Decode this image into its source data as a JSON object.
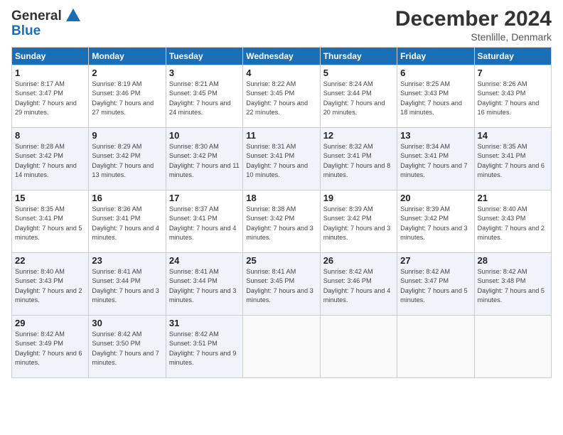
{
  "logo": {
    "line1": "General",
    "line2": "Blue"
  },
  "header": {
    "month": "December 2024",
    "location": "Stenlille, Denmark"
  },
  "weekdays": [
    "Sunday",
    "Monday",
    "Tuesday",
    "Wednesday",
    "Thursday",
    "Friday",
    "Saturday"
  ],
  "weeks": [
    [
      {
        "day": "1",
        "sunrise": "Sunrise: 8:17 AM",
        "sunset": "Sunset: 3:47 PM",
        "daylight": "Daylight: 7 hours and 29 minutes."
      },
      {
        "day": "2",
        "sunrise": "Sunrise: 8:19 AM",
        "sunset": "Sunset: 3:46 PM",
        "daylight": "Daylight: 7 hours and 27 minutes."
      },
      {
        "day": "3",
        "sunrise": "Sunrise: 8:21 AM",
        "sunset": "Sunset: 3:45 PM",
        "daylight": "Daylight: 7 hours and 24 minutes."
      },
      {
        "day": "4",
        "sunrise": "Sunrise: 8:22 AM",
        "sunset": "Sunset: 3:45 PM",
        "daylight": "Daylight: 7 hours and 22 minutes."
      },
      {
        "day": "5",
        "sunrise": "Sunrise: 8:24 AM",
        "sunset": "Sunset: 3:44 PM",
        "daylight": "Daylight: 7 hours and 20 minutes."
      },
      {
        "day": "6",
        "sunrise": "Sunrise: 8:25 AM",
        "sunset": "Sunset: 3:43 PM",
        "daylight": "Daylight: 7 hours and 18 minutes."
      },
      {
        "day": "7",
        "sunrise": "Sunrise: 8:26 AM",
        "sunset": "Sunset: 3:43 PM",
        "daylight": "Daylight: 7 hours and 16 minutes."
      }
    ],
    [
      {
        "day": "8",
        "sunrise": "Sunrise: 8:28 AM",
        "sunset": "Sunset: 3:42 PM",
        "daylight": "Daylight: 7 hours and 14 minutes."
      },
      {
        "day": "9",
        "sunrise": "Sunrise: 8:29 AM",
        "sunset": "Sunset: 3:42 PM",
        "daylight": "Daylight: 7 hours and 13 minutes."
      },
      {
        "day": "10",
        "sunrise": "Sunrise: 8:30 AM",
        "sunset": "Sunset: 3:42 PM",
        "daylight": "Daylight: 7 hours and 11 minutes."
      },
      {
        "day": "11",
        "sunrise": "Sunrise: 8:31 AM",
        "sunset": "Sunset: 3:41 PM",
        "daylight": "Daylight: 7 hours and 10 minutes."
      },
      {
        "day": "12",
        "sunrise": "Sunrise: 8:32 AM",
        "sunset": "Sunset: 3:41 PM",
        "daylight": "Daylight: 7 hours and 8 minutes."
      },
      {
        "day": "13",
        "sunrise": "Sunrise: 8:34 AM",
        "sunset": "Sunset: 3:41 PM",
        "daylight": "Daylight: 7 hours and 7 minutes."
      },
      {
        "day": "14",
        "sunrise": "Sunrise: 8:35 AM",
        "sunset": "Sunset: 3:41 PM",
        "daylight": "Daylight: 7 hours and 6 minutes."
      }
    ],
    [
      {
        "day": "15",
        "sunrise": "Sunrise: 8:35 AM",
        "sunset": "Sunset: 3:41 PM",
        "daylight": "Daylight: 7 hours and 5 minutes."
      },
      {
        "day": "16",
        "sunrise": "Sunrise: 8:36 AM",
        "sunset": "Sunset: 3:41 PM",
        "daylight": "Daylight: 7 hours and 4 minutes."
      },
      {
        "day": "17",
        "sunrise": "Sunrise: 8:37 AM",
        "sunset": "Sunset: 3:41 PM",
        "daylight": "Daylight: 7 hours and 4 minutes."
      },
      {
        "day": "18",
        "sunrise": "Sunrise: 8:38 AM",
        "sunset": "Sunset: 3:42 PM",
        "daylight": "Daylight: 7 hours and 3 minutes."
      },
      {
        "day": "19",
        "sunrise": "Sunrise: 8:39 AM",
        "sunset": "Sunset: 3:42 PM",
        "daylight": "Daylight: 7 hours and 3 minutes."
      },
      {
        "day": "20",
        "sunrise": "Sunrise: 8:39 AM",
        "sunset": "Sunset: 3:42 PM",
        "daylight": "Daylight: 7 hours and 3 minutes."
      },
      {
        "day": "21",
        "sunrise": "Sunrise: 8:40 AM",
        "sunset": "Sunset: 3:43 PM",
        "daylight": "Daylight: 7 hours and 2 minutes."
      }
    ],
    [
      {
        "day": "22",
        "sunrise": "Sunrise: 8:40 AM",
        "sunset": "Sunset: 3:43 PM",
        "daylight": "Daylight: 7 hours and 2 minutes."
      },
      {
        "day": "23",
        "sunrise": "Sunrise: 8:41 AM",
        "sunset": "Sunset: 3:44 PM",
        "daylight": "Daylight: 7 hours and 3 minutes."
      },
      {
        "day": "24",
        "sunrise": "Sunrise: 8:41 AM",
        "sunset": "Sunset: 3:44 PM",
        "daylight": "Daylight: 7 hours and 3 minutes."
      },
      {
        "day": "25",
        "sunrise": "Sunrise: 8:41 AM",
        "sunset": "Sunset: 3:45 PM",
        "daylight": "Daylight: 7 hours and 3 minutes."
      },
      {
        "day": "26",
        "sunrise": "Sunrise: 8:42 AM",
        "sunset": "Sunset: 3:46 PM",
        "daylight": "Daylight: 7 hours and 4 minutes."
      },
      {
        "day": "27",
        "sunrise": "Sunrise: 8:42 AM",
        "sunset": "Sunset: 3:47 PM",
        "daylight": "Daylight: 7 hours and 5 minutes."
      },
      {
        "day": "28",
        "sunrise": "Sunrise: 8:42 AM",
        "sunset": "Sunset: 3:48 PM",
        "daylight": "Daylight: 7 hours and 5 minutes."
      }
    ],
    [
      {
        "day": "29",
        "sunrise": "Sunrise: 8:42 AM",
        "sunset": "Sunset: 3:49 PM",
        "daylight": "Daylight: 7 hours and 6 minutes."
      },
      {
        "day": "30",
        "sunrise": "Sunrise: 8:42 AM",
        "sunset": "Sunset: 3:50 PM",
        "daylight": "Daylight: 7 hours and 7 minutes."
      },
      {
        "day": "31",
        "sunrise": "Sunrise: 8:42 AM",
        "sunset": "Sunset: 3:51 PM",
        "daylight": "Daylight: 7 hours and 9 minutes."
      },
      null,
      null,
      null,
      null
    ]
  ]
}
